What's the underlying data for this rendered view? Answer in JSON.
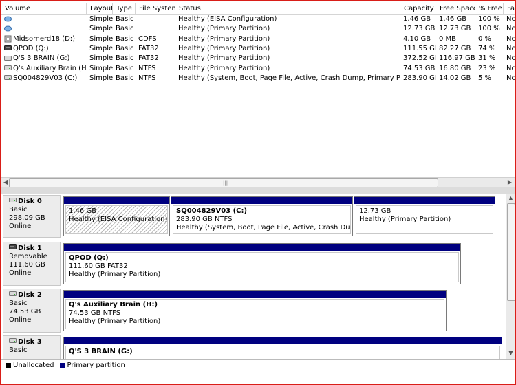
{
  "columns": [
    "Volume",
    "Layout",
    "Type",
    "File System",
    "Status",
    "Capacity",
    "Free Space",
    "% Free",
    "Fa"
  ],
  "rows": [
    {
      "icon": "disk-blue-icon",
      "volume": "",
      "layout": "Simple",
      "type": "Basic",
      "fs": "",
      "status": "Healthy (EISA Configuration)",
      "capacity": "1.46 GB",
      "free": "1.46 GB",
      "pct": "100 %",
      "fault": "Nc"
    },
    {
      "icon": "disk-blue-icon",
      "volume": "",
      "layout": "Simple",
      "type": "Basic",
      "fs": "",
      "status": "Healthy (Primary Partition)",
      "capacity": "12.73 GB",
      "free": "12.73 GB",
      "pct": "100 %",
      "fault": "Nc"
    },
    {
      "icon": "cd-drive-icon",
      "volume": "Midsomerd18 (D:)",
      "layout": "Simple",
      "type": "Basic",
      "fs": "CDFS",
      "status": "Healthy (Primary Partition)",
      "capacity": "4.10 GB",
      "free": "0 MB",
      "pct": "0 %",
      "fault": "Nc"
    },
    {
      "icon": "removable-drive-icon",
      "volume": "QPOD (Q:)",
      "layout": "Simple",
      "type": "Basic",
      "fs": "FAT32",
      "status": "Healthy (Primary Partition)",
      "capacity": "111.55 GB",
      "free": "82.27 GB",
      "pct": "74 %",
      "fault": "Nc"
    },
    {
      "icon": "hard-drive-icon",
      "volume": "Q'S 3 BRAIN (G:)",
      "layout": "Simple",
      "type": "Basic",
      "fs": "FAT32",
      "status": "Healthy (Primary Partition)",
      "capacity": "372.52 GB",
      "free": "116.97 GB",
      "pct": "31 %",
      "fault": "Nc"
    },
    {
      "icon": "hard-drive-icon",
      "volume": "Q's Auxiliary Brain (H:)",
      "layout": "Simple",
      "type": "Basic",
      "fs": "NTFS",
      "status": "Healthy (Primary Partition)",
      "capacity": "74.53 GB",
      "free": "16.80 GB",
      "pct": "23 %",
      "fault": "Nc"
    },
    {
      "icon": "hard-drive-icon",
      "volume": "SQ004829V03 (C:)",
      "layout": "Simple",
      "type": "Basic",
      "fs": "NTFS",
      "status": "Healthy (System, Boot, Page File, Active, Crash Dump, Primary Partition)",
      "capacity": "283.90 GB",
      "free": "14.02 GB",
      "pct": "5 %",
      "fault": "Nc"
    }
  ],
  "disks": [
    {
      "name": "Disk 0",
      "kind": "Basic",
      "size": "298.09 GB",
      "state": "Online",
      "parts": [
        {
          "title": "",
          "line1": "1.46 GB",
          "line2": "Healthy (EISA Configuration)",
          "hatched": true
        },
        {
          "title": "SQ004829V03  (C:)",
          "line1": "283.90 GB NTFS",
          "line2": "Healthy (System, Boot, Page File, Active, Crash Dump, Prir",
          "hatched": false
        },
        {
          "title": "",
          "line1": "12.73 GB",
          "line2": "Healthy (Primary Partition)",
          "hatched": false
        }
      ]
    },
    {
      "name": "Disk 1",
      "kind": "Removable",
      "size": "111.60 GB",
      "state": "Online",
      "parts": [
        {
          "title": "QPOD  (Q:)",
          "line1": "111.60 GB FAT32",
          "line2": "Healthy (Primary Partition)",
          "hatched": false
        }
      ]
    },
    {
      "name": "Disk 2",
      "kind": "Basic",
      "size": "74.53 GB",
      "state": "Online",
      "parts": [
        {
          "title": "Q's Auxiliary Brain  (H:)",
          "line1": "74.53 GB NTFS",
          "line2": "Healthy (Primary Partition)",
          "hatched": false
        }
      ]
    },
    {
      "name": "Disk 3",
      "kind": "Basic",
      "size": "",
      "state": "",
      "parts": [
        {
          "title": "Q'S 3 BRAIN  (G:)",
          "line1": "",
          "line2": "",
          "hatched": false
        }
      ]
    }
  ],
  "legend": [
    {
      "label": "Unallocated",
      "color": "#000000"
    },
    {
      "label": "Primary partition",
      "color": "#000080"
    }
  ],
  "colors": {
    "partition_bar": "#000080",
    "frame_border": "#d91e18"
  }
}
